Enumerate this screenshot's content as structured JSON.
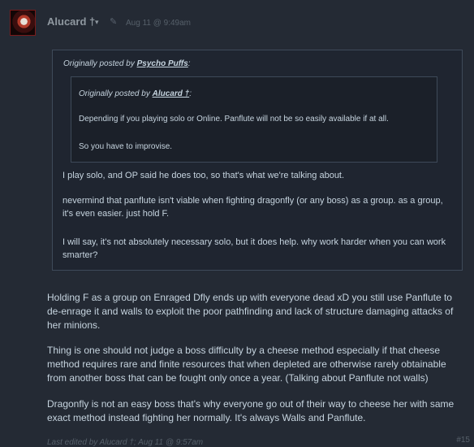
{
  "post": {
    "author": "Alucard †",
    "caret": "▾",
    "edit_icon": "✎",
    "timestamp": "Aug 11 @ 9:49am",
    "post_number": "#15",
    "last_edited": "Last edited by Alucard †; Aug 11 @ 9:57am"
  },
  "outer_quote": {
    "prefix": "Originally posted by ",
    "name": "Psycho Puffs",
    "suffix": ":",
    "inner_quote": {
      "prefix": "Originally posted by ",
      "name": "Alucard †",
      "suffix": ":",
      "lines": [
        "Depending if you playing solo or Online. Panflute will not be so easily available if at all.",
        "So you have to improvise."
      ]
    },
    "paragraphs": [
      "I play solo, and OP said he does too, so that's what we're talking about.",
      "nevermind that panflute isn't viable when fighting dragonfly (or any boss) as a group. as a group, it's even easier. just hold F.",
      "I will say, it's not absolutely necessary solo, but it does help. why work harder when you can work smarter?"
    ]
  },
  "body": {
    "paragraphs": [
      "Holding F as a group on Enraged Dfly ends up with everyone dead xD you still use Panflute to de-enrage it and walls to exploit the poor pathfinding and lack of structure damaging attacks of her minions.",
      "Thing is one should not judge a boss difficulty by a cheese method especially if that cheese method requires rare and finite resources that when depleted are otherwise rarely obtainable from another boss that can be fought only once a year. (Talking about Panflute not walls)",
      "Dragonfly is not an easy boss that's why everyone go out of their way to cheese her with same exact method instead fighting her normally. It's always Walls and Panflute."
    ]
  },
  "icons": {
    "avatar": "avatar-image",
    "edit": "pencil-icon",
    "caret": "chevron-down-icon"
  },
  "colors": {
    "background": "#242a34",
    "quote_background": "#1f2530",
    "quote_border": "#3e4a59",
    "text": "#c6d4df",
    "muted": "#56606a"
  }
}
